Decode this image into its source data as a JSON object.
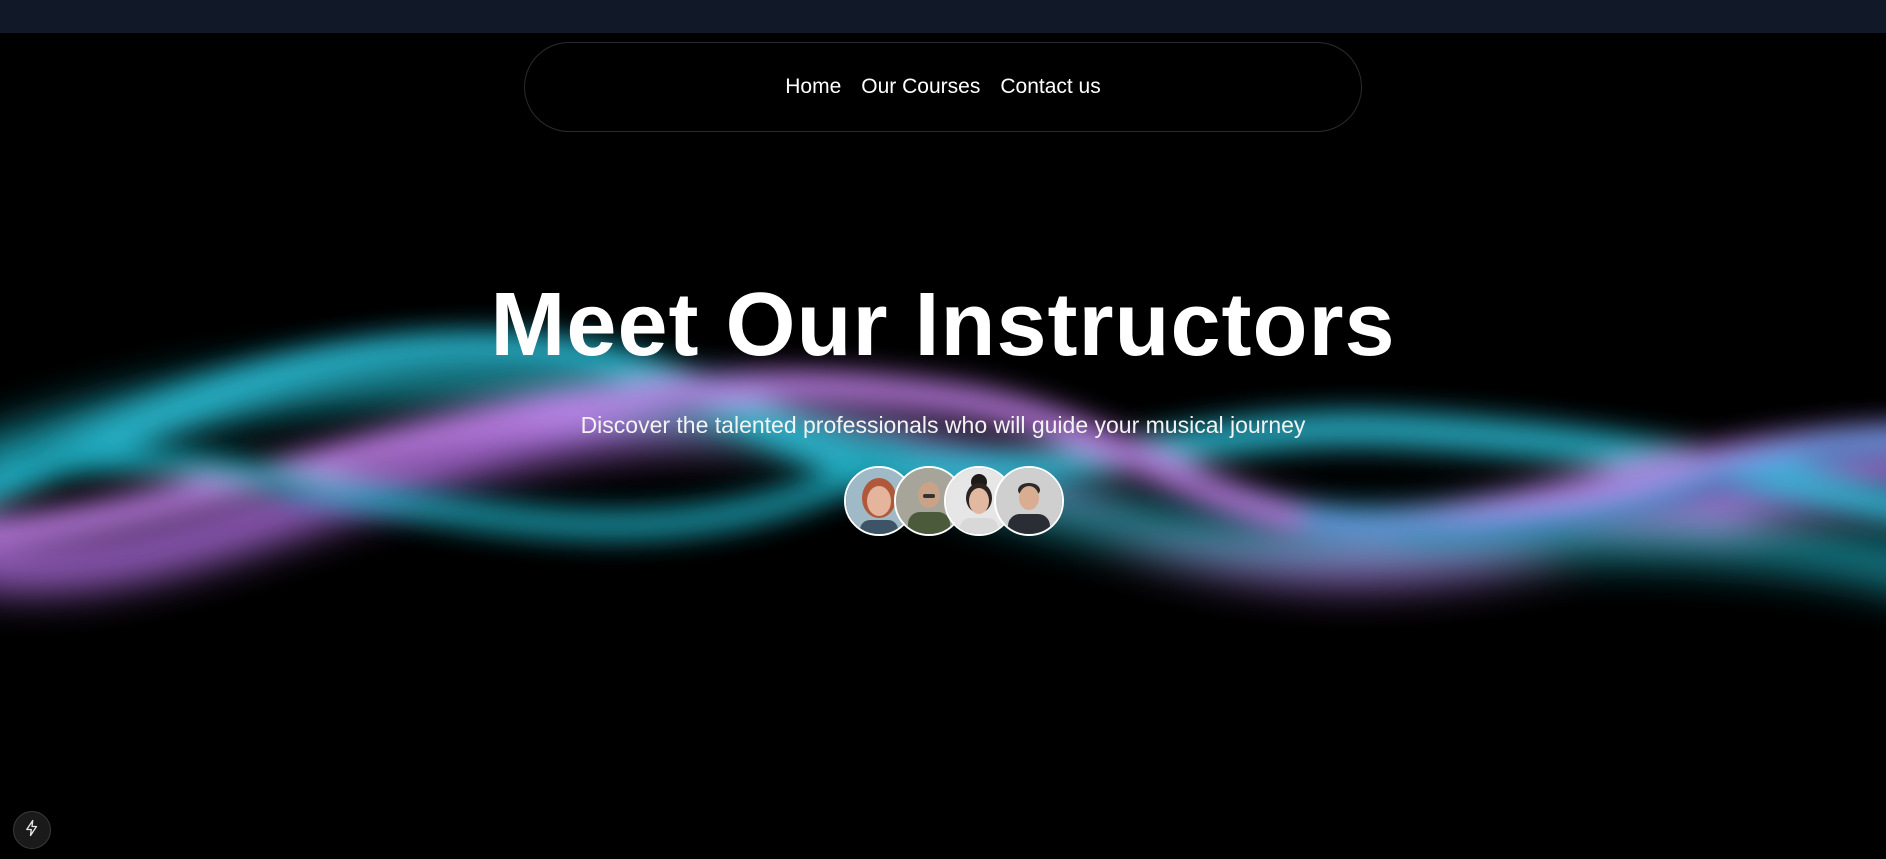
{
  "nav": {
    "items": [
      {
        "label": "Home"
      },
      {
        "label": "Our Courses"
      },
      {
        "label": "Contact us"
      }
    ]
  },
  "hero": {
    "title": "Meet Our Instructors",
    "subtitle": "Discover the talented professionals who will guide your musical journey"
  },
  "avatars": [
    {
      "name": "instructor-1"
    },
    {
      "name": "instructor-2"
    },
    {
      "name": "instructor-3"
    },
    {
      "name": "instructor-4"
    }
  ],
  "colors": {
    "topbar": "#111827",
    "background": "#000000",
    "wave_cyan": "#22b8cf",
    "wave_pink": "#c77dff",
    "text": "#ffffff"
  },
  "icons": {
    "corner_badge": "lightning-icon"
  }
}
